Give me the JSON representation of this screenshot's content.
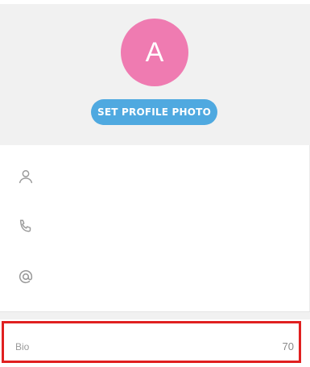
{
  "profile": {
    "avatar_letter": "A",
    "avatar_color": "#ef7bb1",
    "set_photo_label": "SET PROFILE PHOTO",
    "accent_color": "#4fa9e0"
  },
  "fields": [
    {
      "icon": "person-icon",
      "value": "",
      "placeholder": ""
    },
    {
      "icon": "phone-icon",
      "value": "",
      "placeholder": ""
    },
    {
      "icon": "at-sign-icon",
      "value": "",
      "placeholder": ""
    }
  ],
  "bio": {
    "label": "Bio",
    "counter": "70",
    "highlight_color": "#e02020"
  }
}
